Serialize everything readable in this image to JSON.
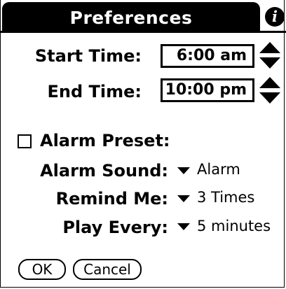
{
  "dialog": {
    "title": "Preferences",
    "info_icon": "i"
  },
  "times": {
    "start_label": "Start Time:",
    "start_value": "6:00 am",
    "end_label": "End Time:",
    "end_value": "10:00 pm"
  },
  "alarm": {
    "preset_label": "Alarm Preset:",
    "preset_checked": false,
    "sound_label": "Alarm Sound:",
    "sound_value": "Alarm",
    "remind_label": "Remind Me:",
    "remind_value": "3 Times",
    "play_label": "Play Every:",
    "play_value": "5 minutes"
  },
  "buttons": {
    "ok": "OK",
    "cancel": "Cancel"
  }
}
